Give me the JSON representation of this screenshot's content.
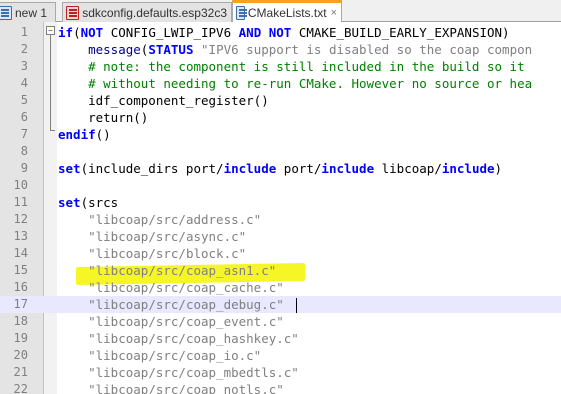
{
  "tabs": [
    {
      "label": "new 1",
      "modified": false,
      "active": false
    },
    {
      "label": "sdkconfig.defaults.esp32c3",
      "modified": true,
      "active": false
    },
    {
      "label": "CMakeLists.txt",
      "modified": false,
      "active": true
    }
  ],
  "editor": {
    "current_line": 17,
    "lines": [
      {
        "n": "1",
        "parts": [
          [
            "kw",
            "if"
          ],
          [
            "p",
            "("
          ],
          [
            "kw",
            "NOT"
          ],
          [
            "p",
            " CONFIG_LWIP_IPV6 "
          ],
          [
            "kw",
            "AND"
          ],
          [
            "p",
            " "
          ],
          [
            "kw",
            "NOT"
          ],
          [
            "p",
            " CMAKE_BUILD_EARLY_EXPANSION)"
          ]
        ]
      },
      {
        "n": "2",
        "parts": [
          [
            "p",
            "    "
          ],
          [
            "fn",
            "message"
          ],
          [
            "p",
            "("
          ],
          [
            "kw",
            "STATUS"
          ],
          [
            "p",
            " "
          ],
          [
            "str",
            "\"IPV6 support is disabled so the coap compon"
          ]
        ]
      },
      {
        "n": "3",
        "parts": [
          [
            "p",
            "    "
          ],
          [
            "cmt",
            "# note: the component is still included in the build so it"
          ]
        ]
      },
      {
        "n": "4",
        "parts": [
          [
            "p",
            "    "
          ],
          [
            "cmt",
            "# without needing to re-run CMake. However no source or hea"
          ]
        ]
      },
      {
        "n": "5",
        "parts": [
          [
            "p",
            "    idf_component_register()"
          ]
        ]
      },
      {
        "n": "6",
        "parts": [
          [
            "p",
            "    return()"
          ]
        ]
      },
      {
        "n": "7",
        "parts": [
          [
            "kw",
            "endif"
          ],
          [
            "p",
            "()"
          ]
        ]
      },
      {
        "n": "8",
        "parts": []
      },
      {
        "n": "9",
        "parts": [
          [
            "kw",
            "set"
          ],
          [
            "p",
            "(include_dirs port/"
          ],
          [
            "kw",
            "include"
          ],
          [
            "p",
            " port/"
          ],
          [
            "kw",
            "include"
          ],
          [
            "p",
            " libcoap/"
          ],
          [
            "kw",
            "include"
          ],
          [
            "p",
            ")"
          ]
        ]
      },
      {
        "n": "10",
        "parts": []
      },
      {
        "n": "11",
        "parts": [
          [
            "kw",
            "set"
          ],
          [
            "p",
            "(srcs"
          ]
        ]
      },
      {
        "n": "12",
        "parts": [
          [
            "p",
            "    "
          ],
          [
            "str",
            "\"libcoap/src/address.c\""
          ]
        ]
      },
      {
        "n": "13",
        "parts": [
          [
            "p",
            "    "
          ],
          [
            "str",
            "\"libcoap/src/async.c\""
          ]
        ]
      },
      {
        "n": "14",
        "parts": [
          [
            "p",
            "    "
          ],
          [
            "str",
            "\"libcoap/src/block.c\""
          ]
        ]
      },
      {
        "n": "15",
        "parts": [
          [
            "p",
            "    "
          ],
          [
            "str",
            "\"libcoap/src/coap_asn1.c\""
          ]
        ]
      },
      {
        "n": "16",
        "parts": [
          [
            "p",
            "    "
          ],
          [
            "str",
            "\"libcoap/src/coap_cache.c\""
          ]
        ]
      },
      {
        "n": "17",
        "parts": [
          [
            "p",
            "    "
          ],
          [
            "str",
            "\"libcoap/src/coap_debug.c\""
          ]
        ]
      },
      {
        "n": "18",
        "parts": [
          [
            "p",
            "    "
          ],
          [
            "str",
            "\"libcoap/src/coap_event.c\""
          ]
        ]
      },
      {
        "n": "19",
        "parts": [
          [
            "p",
            "    "
          ],
          [
            "str",
            "\"libcoap/src/coap_hashkey.c\""
          ]
        ]
      },
      {
        "n": "20",
        "parts": [
          [
            "p",
            "    "
          ],
          [
            "str",
            "\"libcoap/src/coap_io.c\""
          ]
        ]
      },
      {
        "n": "21",
        "parts": [
          [
            "p",
            "    "
          ],
          [
            "str",
            "\"libcoap/src/coap_mbedtls.c\""
          ]
        ]
      },
      {
        "n": "22",
        "parts": [
          [
            "p",
            "    "
          ],
          [
            "str",
            "\"libcoap/src/coap_notls.c\""
          ]
        ]
      }
    ]
  },
  "colors": {
    "keyword": "#0000ff",
    "string": "#808080",
    "comment": "#008000",
    "highlighter": "#f5f500",
    "active_tab_accent": "#f7a21b"
  },
  "icons": {
    "tab_file": "file-icon",
    "tab_modified": "modified-file-icon",
    "tab_close": "close-icon"
  }
}
